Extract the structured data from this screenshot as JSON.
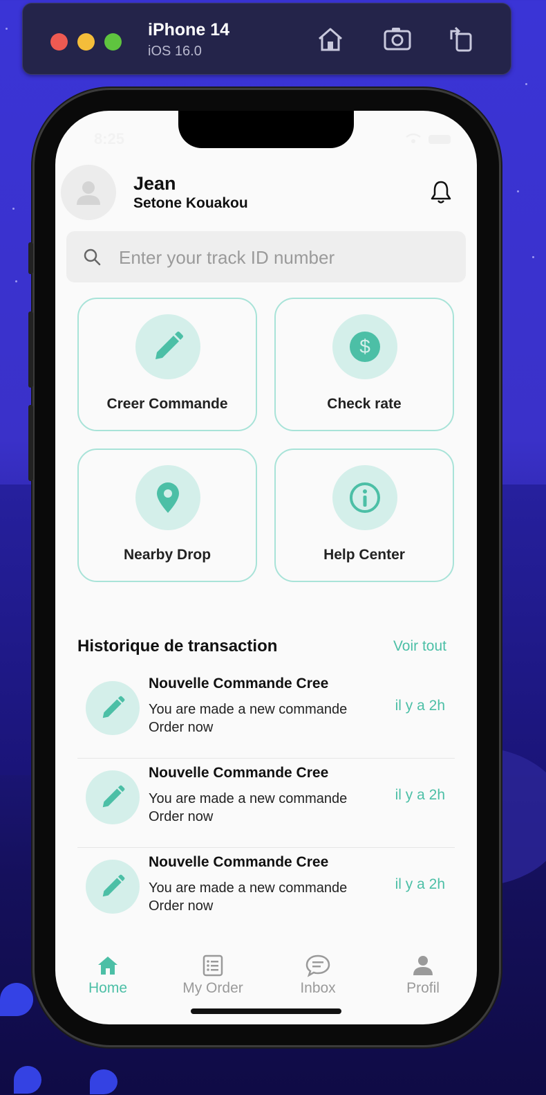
{
  "simulator": {
    "device": "iPhone 14",
    "os": "iOS 16.0"
  },
  "status": {
    "time": "8:25"
  },
  "user": {
    "first_name": "Jean",
    "full_name": "Setone Kouakou"
  },
  "search": {
    "placeholder": "Enter your track ID number"
  },
  "actions": [
    {
      "label": "Creer Commande",
      "icon": "pencil-icon"
    },
    {
      "label": "Check rate",
      "icon": "dollar-icon"
    },
    {
      "label": "Nearby Drop",
      "icon": "location-pin-icon"
    },
    {
      "label": "Help Center",
      "icon": "info-icon"
    }
  ],
  "history": {
    "title": "Historique de transaction",
    "see_all": "Voir tout",
    "items": [
      {
        "title": "Nouvelle Commande Cree",
        "desc": "You are made a new commande Order now",
        "time": "il y a 2h"
      },
      {
        "title": "Nouvelle Commande Cree",
        "desc": "You are made a new commande Order now",
        "time": "il y a 2h"
      },
      {
        "title": "Nouvelle Commande Cree",
        "desc": "You are made a new commande Order now",
        "time": "il y a 2h"
      }
    ]
  },
  "tabs": [
    {
      "label": "Home",
      "active": true
    },
    {
      "label": "My Order"
    },
    {
      "label": "Inbox"
    },
    {
      "label": "Profil"
    }
  ],
  "colors": {
    "accent": "#4cbfa6",
    "accent_light": "#d4efea",
    "card_border": "#a8e3d8"
  }
}
